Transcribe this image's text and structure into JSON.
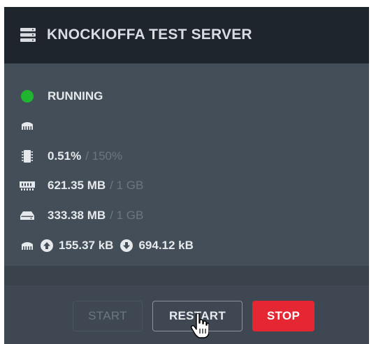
{
  "header": {
    "title": "KNOCKIOFFA TEST SERVER",
    "icon": "server-icon"
  },
  "status": {
    "label": "RUNNING",
    "color": "#1fb52f"
  },
  "stats": {
    "network_address_icon": "network-icon",
    "cpu": {
      "icon": "cpu-icon",
      "used": "0.51%",
      "limit": "/ 150%"
    },
    "memory": {
      "icon": "memory-icon",
      "used": "621.35 MB",
      "limit": "/ 1 GB"
    },
    "disk": {
      "icon": "disk-icon",
      "used": "333.38 MB",
      "limit": "/ 1 GB"
    },
    "network": {
      "icon": "network-icon",
      "upload": "155.37 kB",
      "download": "694.12 kB"
    }
  },
  "actions": {
    "start_label": "START",
    "restart_label": "RESTART",
    "stop_label": "STOP"
  },
  "colors": {
    "stop": "#e52633",
    "header_bg": "#1f252d",
    "panel_bg": "#444e58"
  }
}
